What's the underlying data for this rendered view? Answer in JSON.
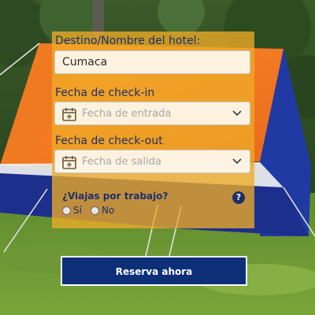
{
  "form": {
    "destination": {
      "label": "Destino/Nombre del hotel:",
      "value": "Cumaca"
    },
    "checkin": {
      "label": "Fecha de check-in",
      "placeholder": "Fecha de entrada"
    },
    "checkout": {
      "label": "Fecha de check-out",
      "placeholder": "Fecha de salida"
    },
    "business_trip": {
      "question": "¿Viajas por trabajo?",
      "help": "?",
      "options": [
        "Sí",
        "No"
      ]
    },
    "submit_label": "Reserva ahora"
  },
  "icons": {
    "date": "calendar-icon",
    "dropdown": "chevron-down-icon",
    "help": "question-circle-icon"
  },
  "colors": {
    "panel": "#eeaa26",
    "text": "#1d2f6a",
    "button": "#0c2f78"
  }
}
